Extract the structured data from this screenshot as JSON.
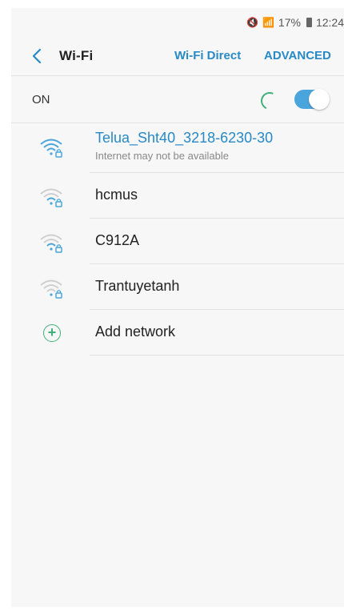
{
  "status_bar": {
    "battery_text": "17%",
    "time": "12:24"
  },
  "header": {
    "title": "Wi-Fi",
    "wifi_direct": "Wi-Fi Direct",
    "advanced": "ADVANCED"
  },
  "toggle_row": {
    "label": "ON",
    "state": "on"
  },
  "networks": [
    {
      "name": "Telua_Sht40_3218-6230-30",
      "subtitle": "Internet may not be available",
      "connected": true
    },
    {
      "name": "hcmus"
    },
    {
      "name": "C912A"
    },
    {
      "name": "Trantuyetanh"
    }
  ],
  "add_network": {
    "label": "Add network"
  },
  "colors": {
    "accent": "#2789c6",
    "toggle": "#4aa5dc",
    "add_icon": "#3fb07a"
  }
}
